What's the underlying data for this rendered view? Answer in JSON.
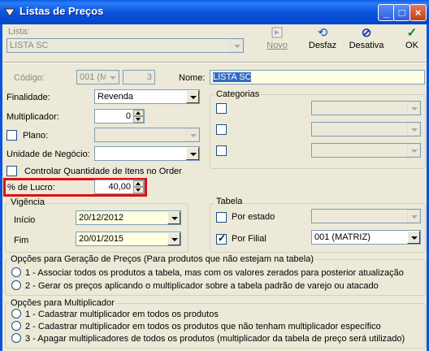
{
  "window": {
    "title": "Listas de Preços",
    "minimize": "_",
    "maximize": "□",
    "close": "×"
  },
  "lista": {
    "label": "Lista:",
    "value": "LISTA SC"
  },
  "toolbar": {
    "novo": "Novo",
    "desfaz": "Desfaz",
    "desativa": "Desativa",
    "ok": "OK"
  },
  "codigo": {
    "label": "Código:",
    "value": "001 (M",
    "seq": "3"
  },
  "nome": {
    "label": "Nome:",
    "value": "LISTA SC"
  },
  "finalidade": {
    "label": "Finalidade:",
    "value": "Revenda"
  },
  "multiplicador": {
    "label": "Multiplicador:",
    "value": "0"
  },
  "plano": {
    "label": "Plano:"
  },
  "unidade": {
    "label": "Unidade de Negócio:"
  },
  "controlar": {
    "label": "Controlar Quantidade de Itens no Order"
  },
  "lucro": {
    "label": "% de Lucro:",
    "value": "40,00"
  },
  "categorias": {
    "title": "Categorias"
  },
  "vigencia": {
    "title": "Vigência",
    "inicio_label": "Início",
    "inicio": "20/12/2012",
    "fim_label": "Fim",
    "fim": "20/01/2015"
  },
  "tabela": {
    "title": "Tabela",
    "por_estado": "Por estado",
    "por_filial": "Por Filial",
    "filial_value": "001 (MATRIZ)"
  },
  "geracao": {
    "title": "Opções para Geração de Preços (Para produtos que não estejam na tabela)",
    "opt1": "1 - Associar todos os produtos a tabela, mas com os valores zerados para posterior atualização",
    "opt2": "2 - Gerar os preços aplicando o multiplicador sobre a tabela padrão de varejo ou atacado"
  },
  "mult_opts": {
    "title": "Opções para Multiplicador",
    "opt1": "1 - Cadastrar multiplicador em todos os produtos",
    "opt2": "2 - Cadastrar multiplicador em todos os produtos que não tenham multiplicador específico",
    "opt3": "3 - Apagar multiplicadores de todos os produtos (multiplicador da tabela de preço será utilizado)"
  }
}
